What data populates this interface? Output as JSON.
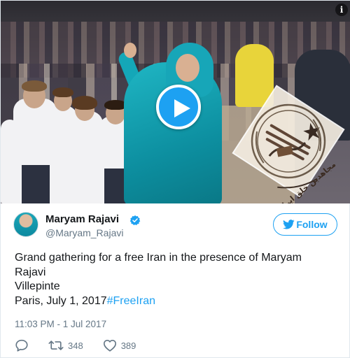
{
  "colors": {
    "twitter_blue": "#1da1f2",
    "text_primary": "#14171a",
    "text_secondary": "#657786",
    "border": "#e1e8ed"
  },
  "media": {
    "type": "video",
    "play_icon": "play-icon",
    "info_icon": "info-icon",
    "info_label": "i",
    "watermark_icon": "organization-emblem-watermark",
    "watermark_text": "مجاهدین خلق ایران"
  },
  "author": {
    "display_name": "Maryam Rajavi",
    "verified": true,
    "verified_icon": "verified-badge-icon",
    "handle": "@Maryam_Rajavi"
  },
  "follow_button": {
    "label": "Follow",
    "icon": "twitter-bird-icon"
  },
  "tweet": {
    "text_line_1": "Grand gathering for a free Iran in the presence of Maryam",
    "text_line_2": "Rajavi",
    "text_line_3": "Villepinte",
    "text_line_4": "Paris, July 1, 2017",
    "hashtag": "#FreeIran",
    "timestamp": "11:03 PM - 1 Jul 2017"
  },
  "actions": {
    "reply_icon": "reply-icon",
    "retweet_icon": "retweet-icon",
    "retweet_count": "348",
    "like_icon": "heart-icon",
    "like_count": "389"
  }
}
